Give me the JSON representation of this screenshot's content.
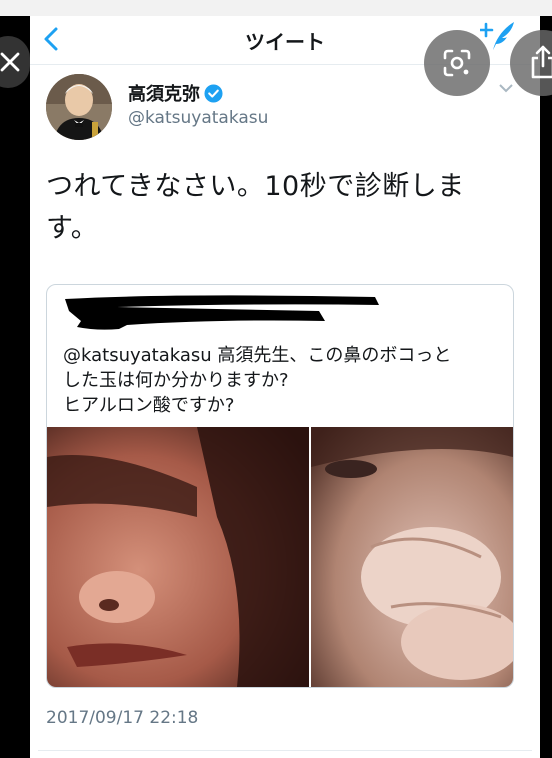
{
  "navbar": {
    "title": "ツイート"
  },
  "tweet": {
    "author_name": "高須克弥",
    "author_handle": "@katsuyatakasu",
    "text_line1": "つれてきなさい。10秒で診断しま",
    "text_line2": "す。",
    "timestamp": "2017/09/17 22:18"
  },
  "quoted_tweet": {
    "line1": "@katsuyatakasu 高須先生、この鼻のボコっと",
    "line2": "した玉は何か分かりますか?",
    "line3": "ヒアルロン酸ですか?"
  },
  "colors": {
    "link_blue": "#1da1f2",
    "text": "#14171a",
    "secondary_text": "#657786",
    "border": "#ccd6dd"
  },
  "icons": [
    "close-icon",
    "back-chevron-icon",
    "compose-tweet-icon",
    "verified-badge-icon",
    "chevron-down-icon",
    "lens-scan-icon",
    "share-icon"
  ]
}
